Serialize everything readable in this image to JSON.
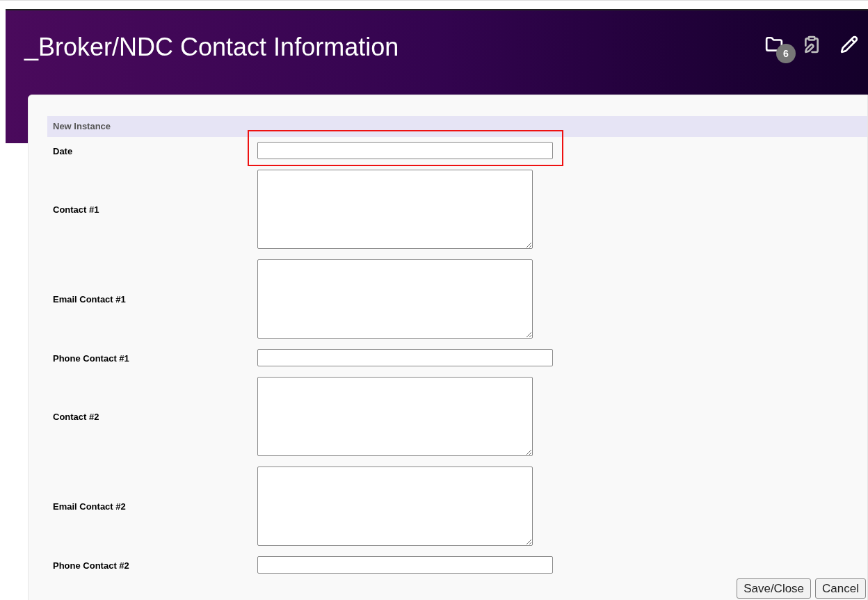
{
  "header": {
    "title": "_Broker/NDC Contact Information",
    "folder_badge": "6"
  },
  "section": {
    "title": "New Instance"
  },
  "fields": [
    {
      "label": "Date",
      "kind": "input",
      "highlighted": true
    },
    {
      "label": "Contact #1",
      "kind": "textarea",
      "highlighted": false
    },
    {
      "label": "Email Contact #1",
      "kind": "textarea",
      "highlighted": false
    },
    {
      "label": "Phone Contact #1",
      "kind": "input",
      "highlighted": false
    },
    {
      "label": "Contact #2",
      "kind": "textarea",
      "highlighted": false
    },
    {
      "label": "Email Contact #2",
      "kind": "textarea",
      "highlighted": false
    },
    {
      "label": "Phone Contact #2",
      "kind": "input",
      "highlighted": false
    }
  ],
  "buttons": [
    "Save/Close",
    "Cancel"
  ]
}
